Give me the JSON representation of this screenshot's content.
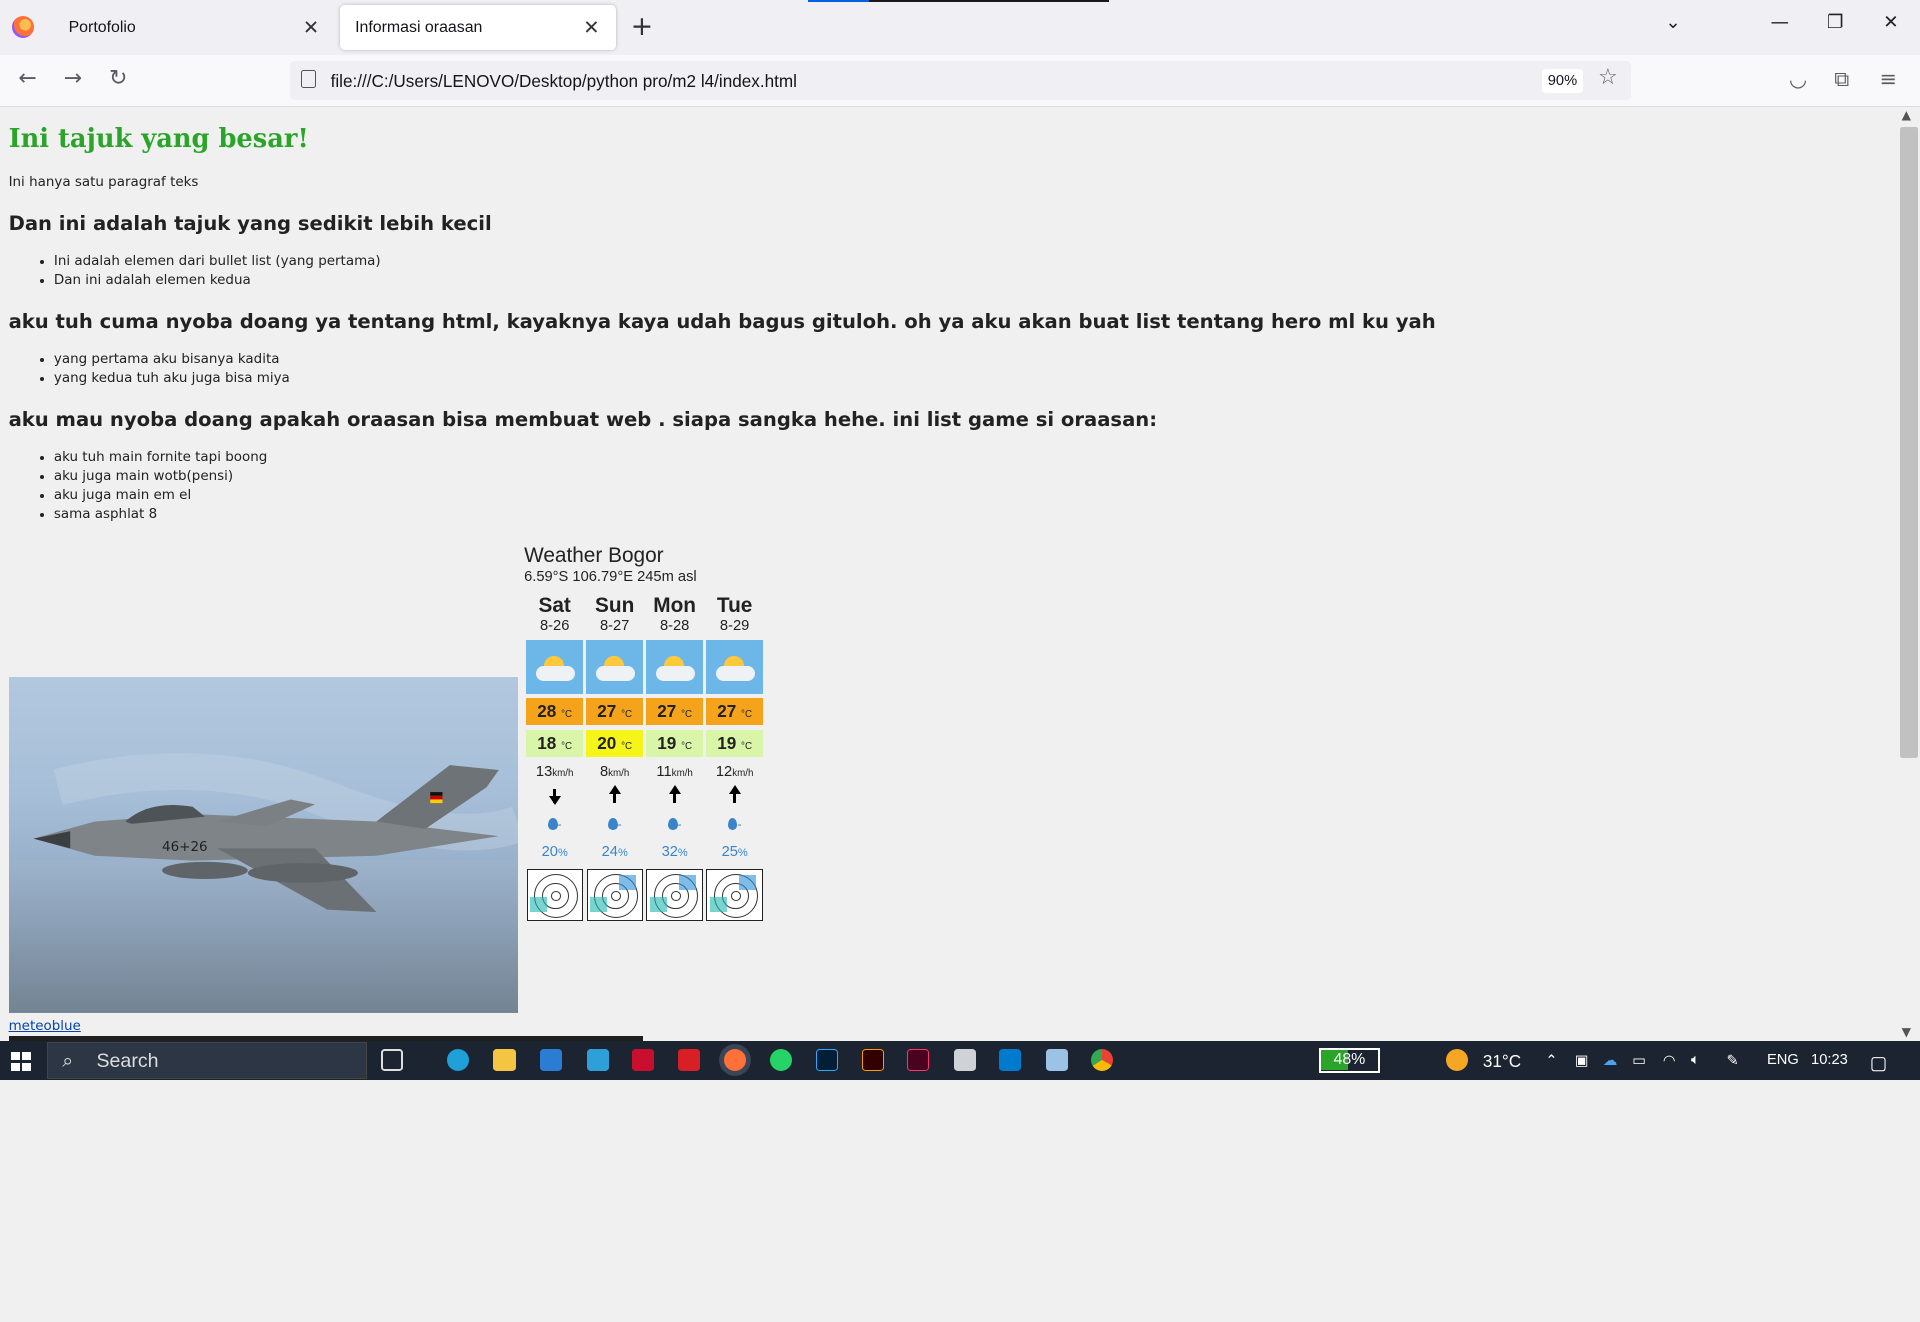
{
  "browser": {
    "tabs": [
      {
        "label": "Portofolio"
      },
      {
        "label": "Informasi oraasan"
      }
    ],
    "close_glyph": "✕",
    "newtab_glyph": "+",
    "url": "file:///C:/Users/LENOVO/Desktop/python pro/m2 l4/index.html",
    "zoom": "90%"
  },
  "page": {
    "heading1": "Ini tajuk yang besar!",
    "paragraph": "Ini hanya satu paragraf teks",
    "heading2a": "Dan ini adalah tajuk yang sedikit lebih kecil",
    "list_a": [
      "Ini adalah elemen dari bullet list (yang pertama)",
      "Dan ini adalah elemen kedua"
    ],
    "heading2b": "aku tuh cuma nyoba doang ya tentang html, kayaknya kaya udah bagus gituloh. oh ya aku akan buat list tentang hero ml ku yah",
    "list_b": [
      "yang pertama aku bisanya kadita",
      "yang kedua tuh aku juga bisa miya"
    ],
    "heading2c": "aku mau nyoba doang apakah oraasan bisa membuat web . siapa sangka hehe. ini list game si oraasan:",
    "list_c": [
      "aku tuh main fornite tapi boong",
      "aku juga main wotb(pensi)",
      "aku juga main em el",
      "sama asphlat 8"
    ],
    "jet_marking": "46+26",
    "meteoblue_link": "meteoblue"
  },
  "weather": {
    "title": "Weather Bogor",
    "coords": "6.59°S 106.79°E 245m asl",
    "temp_unit": "°C",
    "wind_unit": "km/h",
    "rain_value": "-",
    "prob_unit": "%",
    "days": [
      {
        "day": "Sat",
        "date": "8-26",
        "max": "28",
        "min": "18",
        "wind": "13",
        "wind_dir": "down",
        "prob": "20",
        "max_color": "#f5a31a",
        "min_color": "#d9f5a8"
      },
      {
        "day": "Sun",
        "date": "8-27",
        "max": "27",
        "min": "20",
        "wind": "8",
        "wind_dir": "up",
        "prob": "24",
        "max_color": "#f5a31a",
        "min_color": "#f5f51a"
      },
      {
        "day": "Mon",
        "date": "8-28",
        "max": "27",
        "min": "19",
        "wind": "11",
        "wind_dir": "up",
        "prob": "32",
        "max_color": "#f5a31a",
        "min_color": "#d9f5a8"
      },
      {
        "day": "Tue",
        "date": "8-29",
        "max": "27",
        "min": "19",
        "wind": "12",
        "wind_dir": "up",
        "prob": "25",
        "max_color": "#f5a31a",
        "min_color": "#d9f5a8"
      }
    ]
  },
  "taskbar": {
    "search_label": "Search",
    "battery": "48%",
    "temperature": "31°C",
    "language": "ENG",
    "time": "10:23"
  },
  "colors": {
    "heading_green": "#2aa52a",
    "link_blue": "#0645ad",
    "taskbar_bg": "#1c2431"
  }
}
